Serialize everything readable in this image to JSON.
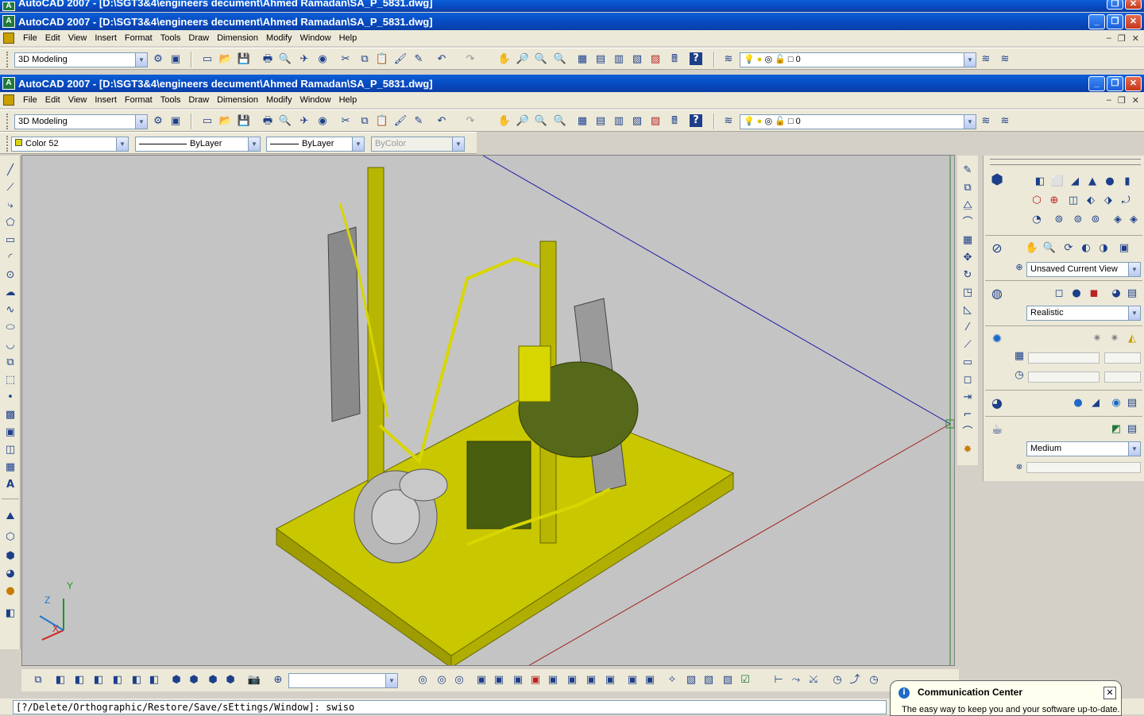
{
  "outer_window": {
    "title": "AutoCAD 2007 - [D:\\SGT3&4\\engineers decument\\Ahmed Ramadan\\SA_P_5831.dwg]",
    "title_clipped": "AutoCAD 2007 - [D:\\SGT3&4\\engineers decument\\Ahmed Ramadan\\SA_P_5831.dwg]"
  },
  "inner_window": {
    "title": "AutoCAD 2007 - [D:\\SGT3&4\\engineers decument\\Ahmed Ramadan\\SA_P_5831.dwg]"
  },
  "menu": [
    "File",
    "Edit",
    "View",
    "Insert",
    "Format",
    "Tools",
    "Draw",
    "Dimension",
    "Modify",
    "Window",
    "Help"
  ],
  "workspace_combo": "3D Modeling",
  "layer_combo": "0",
  "properties": {
    "color": "Color 52",
    "linetype": "ByLayer",
    "lineweight": "ByLayer",
    "plotstyle": "ByColor"
  },
  "dashboard": {
    "view_combo": "Unsaved Current View",
    "visual_style_combo": "Realistic",
    "render_combo": "Medium"
  },
  "command_line": "[?/Delete/Orthographic/Restore/Save/sEttings/Window]:  swiso",
  "comm_center": {
    "title": "Communication Center",
    "message": "The easy way to keep you and your software up-to-date."
  },
  "colors": {
    "model_yellow": "#d8d600",
    "viewport_bg": "#c4c4c4",
    "title_blue": "#0a5fd8"
  }
}
